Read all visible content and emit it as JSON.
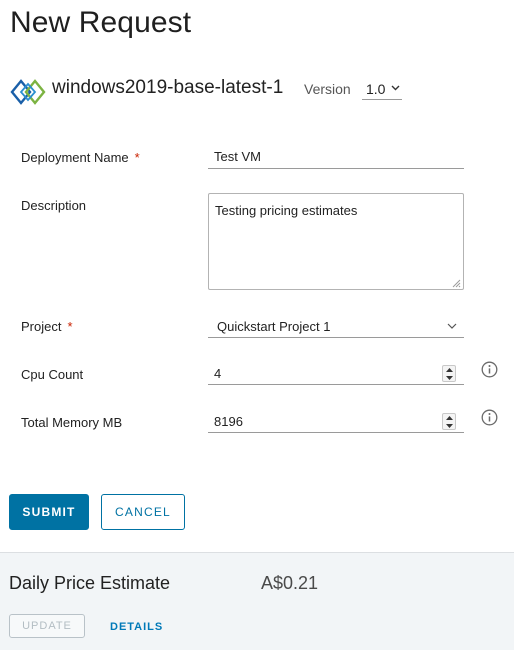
{
  "page": {
    "title": "New Request"
  },
  "blueprint": {
    "name": "windows2019-base-latest-1",
    "version_label": "Version",
    "version_value": "1.0"
  },
  "form": {
    "deployment_name": {
      "label": "Deployment Name",
      "required_mark": "*",
      "value": "Test VM"
    },
    "description": {
      "label": "Description",
      "value": "Testing pricing estimates"
    },
    "project": {
      "label": "Project",
      "required_mark": "*",
      "value": "Quickstart Project 1"
    },
    "cpu_count": {
      "label": "Cpu Count",
      "value": "4"
    },
    "total_memory": {
      "label": "Total Memory MB",
      "value": "8196"
    }
  },
  "actions": {
    "submit_label": "SUBMIT",
    "cancel_label": "CANCEL"
  },
  "price_estimate": {
    "title": "Daily Price Estimate",
    "amount": "A$0.21",
    "update_label": "UPDATE",
    "details_label": "DETAILS"
  },
  "colors": {
    "primary": "#0072a3",
    "required": "#c92100",
    "logo_blue": "#1a5fa8",
    "logo_green": "#7cb342",
    "footer_bg": "#f2f5f7"
  },
  "icons": {
    "blueprint": "blueprint-logo-icon",
    "dropdown": "chevron-down-icon",
    "info": "info-circle-icon",
    "spinner_up": "caret-up-icon",
    "spinner_down": "caret-down-icon"
  }
}
